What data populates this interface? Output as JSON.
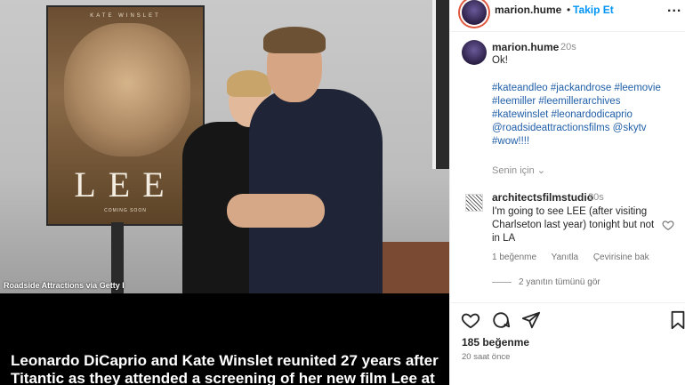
{
  "media": {
    "credit": "Roadside Attractions via Getty I",
    "caption": "Leonardo DiCaprio and Kate Winslet reunited 27 years after Titantic as they attended a screening of her new film Lee at",
    "poster": {
      "top_text": "KATE WINSLET",
      "title": "LEE",
      "coming_soon": "COMING SOON"
    }
  },
  "header": {
    "username": "marion.hume",
    "separator": "•",
    "follow": "Takip Et",
    "more": "..."
  },
  "post": {
    "username": "marion.hume",
    "time": "20s",
    "text": "Ok!",
    "tags": "#kateandleo #jackandrose #leemovie #leemiller #leemillerarchives #katewinslet #leonardodicaprio @roadsideattractionsfilms @skytv #wow!!!!",
    "for_you": "Senin için ⌄"
  },
  "comment": {
    "username": "architectsfilmstudio",
    "time": "20s",
    "text": "I'm going to see LEE (after visiting Charlseton last year) tonight but not in LA",
    "likes": "1 beğenme",
    "reply": "Yanıtla",
    "translate": "Çevirisine bak",
    "view_replies": "2 yanıtın tümünü gör"
  },
  "footer": {
    "likes": "185 beğenme",
    "ago": "20 saat önce"
  },
  "icons": [
    "heart-icon",
    "comment-icon",
    "share-icon",
    "bookmark-icon",
    "more-icon"
  ]
}
